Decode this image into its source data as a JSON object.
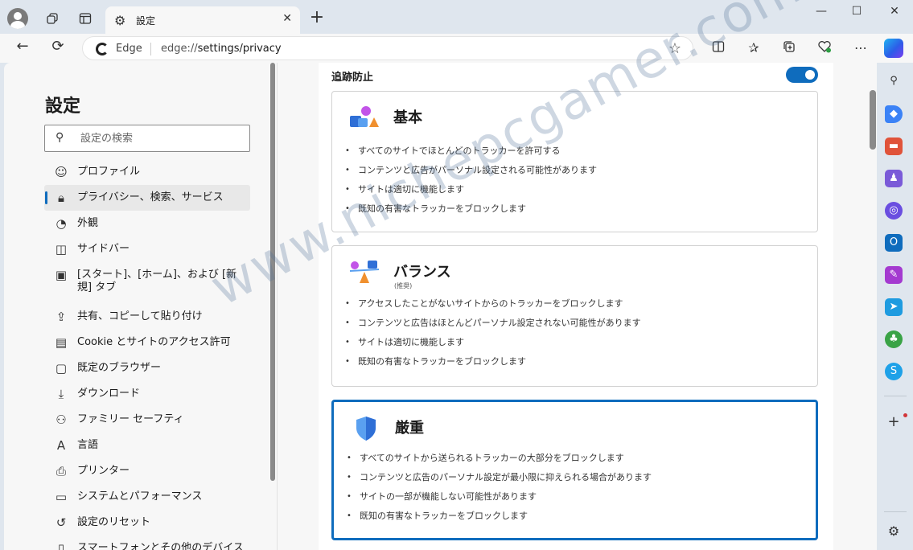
{
  "window": {
    "tab_title": "設定",
    "new_tab_symbol": "+",
    "minimize": "—",
    "maximize": "☐",
    "close": "✕"
  },
  "toolbar": {
    "site_label": "Edge",
    "url_prefix": "edge://",
    "url_path": "settings/privacy"
  },
  "sidebar": {
    "title": "設定",
    "search_placeholder": "設定の検索",
    "items": [
      {
        "label": "プロファイル",
        "icon": "profile-icon"
      },
      {
        "label": "プライバシー、検索、サービス",
        "icon": "lock-icon",
        "active": true
      },
      {
        "label": "外観",
        "icon": "palette-icon"
      },
      {
        "label": "サイドバー",
        "icon": "sidebar-icon"
      },
      {
        "label": "[スタート]、[ホーム]、および [新規] タブ",
        "icon": "home-tab-icon"
      },
      {
        "label": "共有、コピーして貼り付け",
        "icon": "share-icon"
      },
      {
        "label": "Cookie とサイトのアクセス許可",
        "icon": "cookie-icon"
      },
      {
        "label": "既定のブラウザー",
        "icon": "browser-icon"
      },
      {
        "label": "ダウンロード",
        "icon": "download-icon"
      },
      {
        "label": "ファミリー セーフティ",
        "icon": "family-icon"
      },
      {
        "label": "言語",
        "icon": "language-icon"
      },
      {
        "label": "プリンター",
        "icon": "printer-icon"
      },
      {
        "label": "システムとパフォーマンス",
        "icon": "system-icon"
      },
      {
        "label": "設定のリセット",
        "icon": "reset-icon"
      },
      {
        "label": "スマートフォンとその他のデバイス",
        "icon": "phone-icon"
      }
    ]
  },
  "tracking": {
    "title": "追跡防止",
    "enabled": true,
    "options": [
      {
        "title": "基本",
        "subtitle": "",
        "selected": false,
        "bullets": [
          "すべてのサイトでほとんどのトラッカーを許可する",
          "コンテンツと広告がパーソナル設定される可能性があります",
          "サイトは適切に機能します",
          "既知の有害なトラッカーをブロックします"
        ]
      },
      {
        "title": "バランス",
        "subtitle": "(推奨)",
        "selected": false,
        "bullets": [
          "アクセスしたことがないサイトからのトラッカーをブロックします",
          "コンテンツと広告はほとんどパーソナル設定されない可能性があります",
          "サイトは適切に機能します",
          "既知の有害なトラッカーをブロックします"
        ]
      },
      {
        "title": "厳重",
        "subtitle": "",
        "selected": true,
        "bullets": [
          "すべてのサイトから送られるトラッカーの大部分をブロックします",
          "コンテンツと広告のパーソナル設定が最小限に抑えられる場合があります",
          "サイトの一部が機能しない可能性があります",
          "既知の有害なトラッカーをブロックします"
        ]
      }
    ]
  },
  "watermark": "www.nichepcgamer.com",
  "colors": {
    "accent": "#0f6cbd",
    "chrome_bg": "#dfe6ee",
    "page_bg": "#f7f7f7"
  }
}
